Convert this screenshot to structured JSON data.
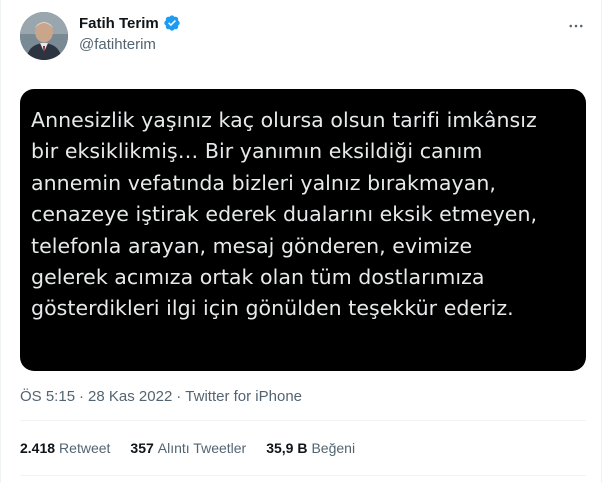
{
  "author": {
    "display_name": "Fatih Terim",
    "handle": "@fatihterim",
    "verified_icon": "verified-badge-icon",
    "verified_color": "#1d9bf0"
  },
  "menu": {
    "more_icon": "more-horizontal-icon"
  },
  "media": {
    "background": "#000000",
    "text_color": "#e7e9ea",
    "lines": [
      "Annesizlik yaşınız kaç olursa olsun tarifi imkânsız",
      "bir eksiklikmiş… Bir yanımın eksildiği canım",
      "annemin vefatında bizleri yalnız bırakmayan,",
      "cenazeye iştirak ederek dualarını eksik etmeyen,",
      "telefonla arayan, mesaj gönderen, evimize",
      "gelerek acımıza ortak olan tüm dostlarımıza",
      "gösterdikleri ilgi için gönülden teşekkür ederiz."
    ]
  },
  "meta": {
    "time": "ÖS 5:15",
    "separator": "·",
    "date": "28 Kas 2022",
    "source": "Twitter for iPhone"
  },
  "stats": {
    "retweets": {
      "count": "2.418",
      "label": "Retweet"
    },
    "quotes": {
      "count": "357",
      "label": "Alıntı Tweetler"
    },
    "likes": {
      "count": "35,9 B",
      "label": "Beğeni"
    }
  }
}
